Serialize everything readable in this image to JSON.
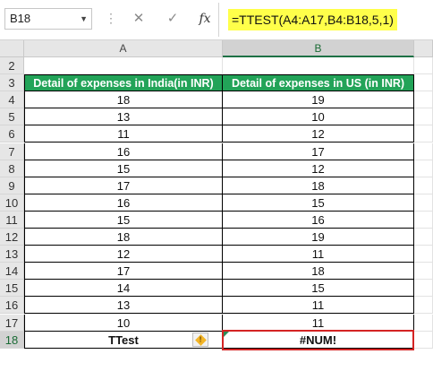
{
  "formula_bar": {
    "name_box": "B18",
    "cancel_symbol": "✕",
    "enter_symbol": "✓",
    "fx_symbol": "fx",
    "formula": "=TTEST(A4:A17,B4:B18,5,1)",
    "highlight_color": "#ffff4a"
  },
  "columns": [
    "A",
    "B"
  ],
  "rows": [
    "2",
    "3",
    "4",
    "5",
    "6",
    "7",
    "8",
    "9",
    "10",
    "11",
    "12",
    "13",
    "14",
    "15",
    "16",
    "17",
    "18"
  ],
  "table": {
    "header_color": "#22a358",
    "headers": [
      "Detail of expenses in India(in INR)",
      "Detail of expenses in US (in INR)"
    ],
    "data": [
      [
        "18",
        "19"
      ],
      [
        "13",
        "10"
      ],
      [
        "11",
        "12"
      ],
      [
        "16",
        "17"
      ],
      [
        "15",
        "12"
      ],
      [
        "17",
        "18"
      ],
      [
        "16",
        "15"
      ],
      [
        "15",
        "16"
      ],
      [
        "18",
        "19"
      ],
      [
        "12",
        "11"
      ],
      [
        "17",
        "18"
      ],
      [
        "14",
        "15"
      ],
      [
        "13",
        "11"
      ],
      [
        "10",
        "11"
      ]
    ],
    "result_label": "TTest",
    "result_value": "#NUM!",
    "error_border_color": "#d42424"
  },
  "icons": {
    "name_box_dropdown": "chevron-down-icon",
    "cancel": "close-icon",
    "enter": "check-icon",
    "function": "fx-icon",
    "warning": "warning-icon"
  }
}
